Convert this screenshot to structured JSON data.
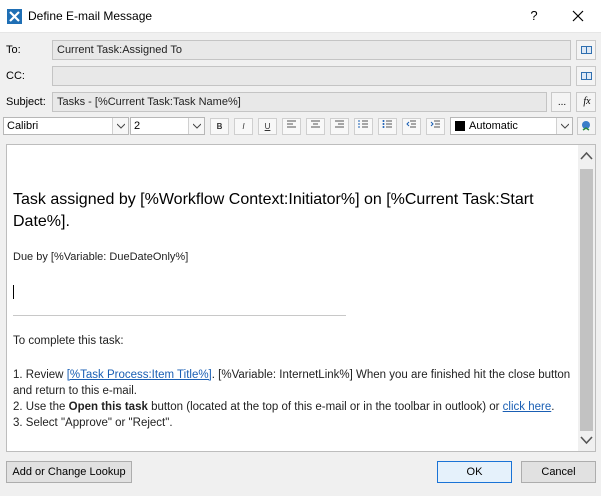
{
  "window": {
    "title": "Define E-mail Message",
    "help": "?"
  },
  "fields": {
    "to": {
      "label": "To:",
      "value": "Current Task:Assigned To"
    },
    "cc": {
      "label": "CC:",
      "value": ""
    },
    "subject": {
      "label": "Subject:",
      "value": "Tasks - [%Current Task:Task Name%]",
      "ellipsis": "...",
      "fx": "fx"
    }
  },
  "toolbar": {
    "font": "Calibri",
    "size": "2",
    "buttons": [
      "B",
      "I",
      "U"
    ],
    "color": {
      "label": "Automatic",
      "swatch": "#000000"
    }
  },
  "body": {
    "heading": "Task assigned by [%Workflow Context:Initiator%] on [%Current Task:Start Date%].",
    "due": "Due by [%Variable: DueDateOnly%]",
    "intro": "To complete this task:",
    "step1_prefix": "1. Review ",
    "step1_link": "[%Task Process:Item Title%]",
    "step1_suffix": ". [%Variable: InternetLink%] When you are finished hit the close button and return to this e-mail.",
    "step2_prefix": "2. Use the ",
    "step2_bold": "Open this task",
    "step2_suffix": " button (located at the top of this e-mail or in the toolbar in outlook) or ",
    "step2_link": "click here",
    "step2_end": ".",
    "step3": "3. Select \"Approve\" or \"Reject\"."
  },
  "buttons": {
    "lookup": "Add or Change Lookup",
    "ok": "OK",
    "cancel": "Cancel"
  }
}
